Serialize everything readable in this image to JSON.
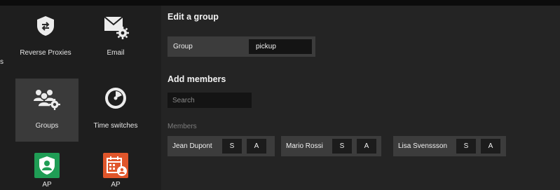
{
  "sidebar": {
    "edge_label": "s",
    "tiles": [
      {
        "label": "Reverse Proxies",
        "icon": "shield-arrows-icon"
      },
      {
        "label": "Email",
        "icon": "envelope-gear-icon"
      },
      {
        "label": "Groups",
        "icon": "group-gear-icon",
        "selected": true
      },
      {
        "label": "Time switches",
        "icon": "timer-dial-icon"
      },
      {
        "label": "AP",
        "icon": "shield-user-icon",
        "color": "#1f9d55"
      },
      {
        "label": "AP",
        "icon": "calendar-user-icon",
        "color": "#e0562b"
      }
    ]
  },
  "main": {
    "title": "Edit a group",
    "group_label": "Group",
    "group_value": "pickup",
    "add_members_title": "Add members",
    "search_placeholder": "Search",
    "members_label": "Members",
    "members": [
      {
        "name": "Jean Dupont",
        "role_s": "S",
        "role_a": "A"
      },
      {
        "name": "Mario Rossi",
        "role_s": "S",
        "role_a": "A"
      },
      {
        "name": "Lisa Svenssson",
        "role_s": "S",
        "role_a": "A"
      }
    ]
  }
}
